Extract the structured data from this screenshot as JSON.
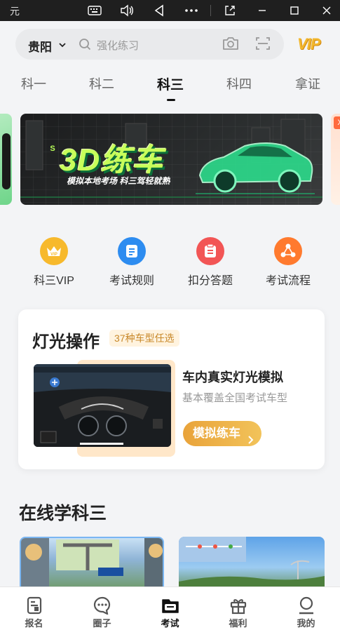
{
  "window": {
    "title": "元"
  },
  "header": {
    "city": "贵阳",
    "search_placeholder": "强化练习",
    "vip_label": "VIP"
  },
  "tabs": [
    {
      "label": "科一",
      "active": false
    },
    {
      "label": "科二",
      "active": false
    },
    {
      "label": "科三",
      "active": true
    },
    {
      "label": "科四",
      "active": false
    },
    {
      "label": "拿证",
      "active": false
    }
  ],
  "banner": {
    "title": "3D练车",
    "subtitle": "模拟本地考场  科三驾轻就熟",
    "badge": "S"
  },
  "quick_entries": [
    {
      "label": "科三VIP",
      "icon": "vip-icon",
      "color": "#f7b92c"
    },
    {
      "label": "考试规则",
      "icon": "document-icon",
      "color": "#2d8cf0"
    },
    {
      "label": "扣分答题",
      "icon": "clipboard-icon",
      "color": "#f25555"
    },
    {
      "label": "考试流程",
      "icon": "share-flow-icon",
      "color": "#ff7a2e"
    }
  ],
  "light_card": {
    "title": "灯光操作",
    "tag": "37种车型任选",
    "heading": "车内真实灯光模拟",
    "description": "基本覆盖全国考试车型",
    "button": "模拟练车"
  },
  "online_section": {
    "title": "在线学科三"
  },
  "bottom_nav": [
    {
      "label": "报名",
      "icon": "register-icon",
      "active": false
    },
    {
      "label": "圈子",
      "icon": "chat-bubble-icon",
      "active": false
    },
    {
      "label": "考试",
      "icon": "exam-folder-icon",
      "active": true
    },
    {
      "label": "福利",
      "icon": "gift-icon",
      "active": false
    },
    {
      "label": "我的",
      "icon": "profile-icon",
      "active": false
    }
  ],
  "colors": {
    "accent_gold": "#e9a33a",
    "banner_green": "#c8ff5a"
  }
}
